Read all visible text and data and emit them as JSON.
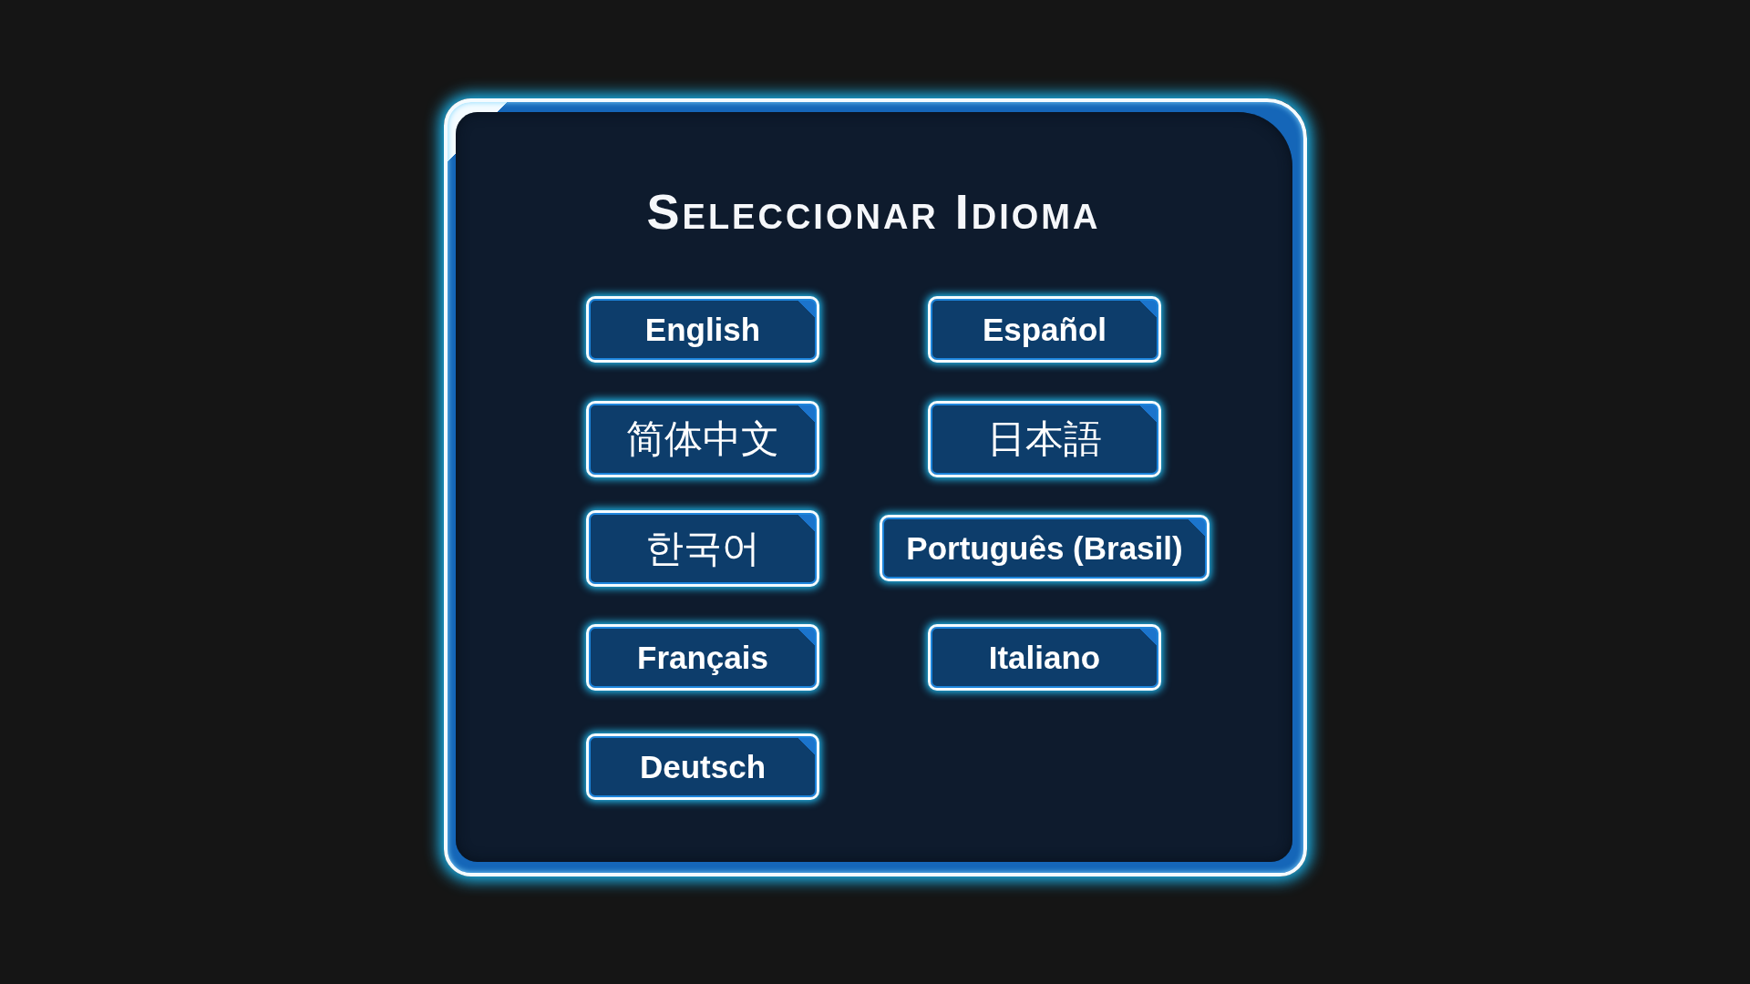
{
  "dialog": {
    "title": "Seleccionar Idioma",
    "languages": [
      {
        "label": "English",
        "kind": "latin"
      },
      {
        "label": "Español",
        "kind": "latin"
      },
      {
        "label": "简体中文",
        "kind": "cjk"
      },
      {
        "label": "日本語",
        "kind": "cjk"
      },
      {
        "label": "한국어",
        "kind": "cjk"
      },
      {
        "label": "Português (Brasil)",
        "kind": "latin"
      },
      {
        "label": "Français",
        "kind": "latin"
      },
      {
        "label": "Italiano",
        "kind": "latin"
      },
      {
        "label": "Deutsch",
        "kind": "latin"
      }
    ]
  }
}
